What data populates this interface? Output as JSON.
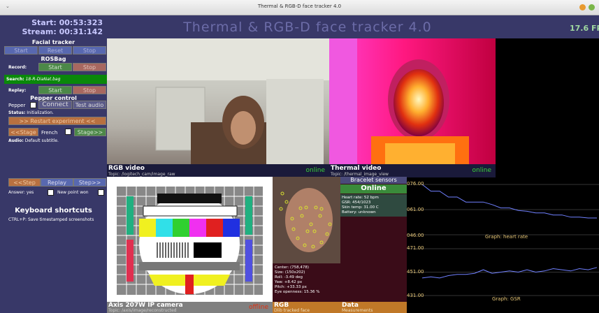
{
  "window": {
    "title": "Thermal & RGB-D face tracker 4.0",
    "menu_glyph": "⌄"
  },
  "header": {
    "start_time": "Start: 00:53:323",
    "stream_time": "Stream: 00:31:142",
    "title": "Thermal & RGB-D face tracker 4.0",
    "fps": "17.6 FP"
  },
  "sidebar": {
    "facial_tracker": {
      "title": "Facial tracker",
      "start": "Start",
      "reset": "Reset",
      "stop": "Stop"
    },
    "rosbag": {
      "title": "ROSBag",
      "record_label": "Record:",
      "record_start": "Start",
      "record_stop": "Stop",
      "search_label": "Search:",
      "search_value": "18-R-DiaNat.bag",
      "replay_label": "Replay:",
      "replay_start": "Start",
      "replay_stop": "Stop"
    },
    "pepper": {
      "title": "Pepper control",
      "pepper_label": "Pepper",
      "connect": "Connect",
      "test_audio": "Test audio",
      "status_label": "Status:",
      "status_value": "Initialization.",
      "restart": ">> Restart experiment <<",
      "stage_prev": "<<Stage",
      "language": "French",
      "stage_next": "Stage>>",
      "audio_label": "Audio:",
      "audio_value": "Default subtitle."
    },
    "steps": {
      "prev": "<<Step",
      "replay": "Replay",
      "next": "Step>>",
      "answer": "Answer: yes",
      "new_point": "New point won"
    },
    "keyboard": {
      "title": "Keyboard shortcuts",
      "shortcut": "CTRL+P: Save timestamped screenshots"
    }
  },
  "rgb_video": {
    "title": "RGB video",
    "topic": "Topic: /logitech_cam/image_raw",
    "status": "online"
  },
  "thermal_video": {
    "title": "Thermal video",
    "topic": "Topic: /thermal_image_view",
    "status": "online"
  },
  "ip_camera": {
    "title": "Axis 207W IP camera",
    "topic": "Topic: /axis/image/reconstructed",
    "status": "offline"
  },
  "rgb_face": {
    "title": "RGB",
    "subtitle": "Dlib tracked face",
    "center": "Center: (758,478)",
    "size": "Size: (150x202)",
    "roll": "Roll: -3.49 deg",
    "yaw": "Yaw: +8.42 px",
    "pitch": "Pitch: +33.33 px",
    "eye": "Eye openness: 15.36 %"
  },
  "bracelet": {
    "title": "Bracelet sensors",
    "status": "Online",
    "heart_rate": "Heart rate: 52 bpm",
    "gsr": "GSR: 454/1023",
    "skin_temp": "Skin temp: 31.00 C",
    "battery": "Battery: unknown"
  },
  "data_panel": {
    "title": "Data",
    "subtitle": "Measurements"
  },
  "colors": {
    "panel": "#383868",
    "online": "#3ad23a",
    "offline": "#e03010",
    "graph_line": "#7080ff",
    "graph_text": "#e8c878"
  },
  "chart_data": [
    {
      "type": "line",
      "title": "Graph: heart rate",
      "ylim": [
        46,
        76
      ],
      "ticks": [
        "076.00",
        "061.00",
        "046.00"
      ],
      "x": [
        0,
        5,
        10,
        15,
        20,
        25,
        30,
        35,
        40,
        45,
        50,
        55,
        60,
        65,
        70,
        75,
        80,
        85,
        90,
        95,
        100
      ],
      "values": [
        76,
        72,
        72,
        68.5,
        68.5,
        65.5,
        65.5,
        65.5,
        64,
        62,
        62,
        60.5,
        60,
        59,
        59,
        57.8,
        57.8,
        56.5,
        56.5,
        56,
        56
      ]
    },
    {
      "type": "line",
      "title": "Graph: GSR",
      "ylim": [
        431,
        471
      ],
      "ticks": [
        "471.00",
        "451.00",
        "431.00"
      ],
      "x": [
        0,
        5,
        10,
        15,
        20,
        25,
        30,
        35,
        40,
        45,
        50,
        55,
        60,
        65,
        70,
        75,
        80,
        85,
        90,
        95,
        100
      ],
      "values": [
        446,
        447,
        446,
        448,
        449,
        449,
        450,
        453,
        450,
        451,
        452,
        451,
        453,
        451,
        452,
        454,
        453,
        452,
        454,
        453,
        455
      ]
    }
  ]
}
